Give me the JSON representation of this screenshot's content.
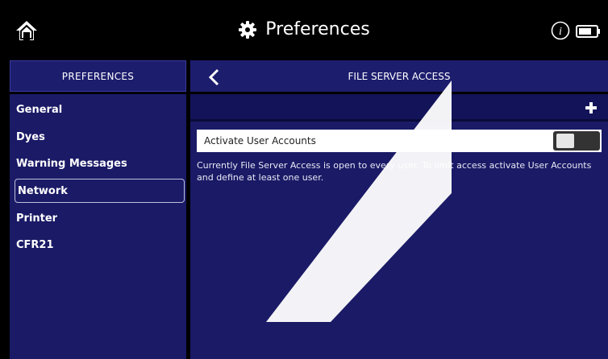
{
  "header": {
    "title": "Preferences",
    "home_icon": "home-icon",
    "gear_icon": "gear-icon",
    "info_icon": "info-icon",
    "battery_icon": "battery-icon"
  },
  "sidebar": {
    "title": "PREFERENCES",
    "items": [
      {
        "label": "General"
      },
      {
        "label": "Dyes"
      },
      {
        "label": "Warning Messages"
      },
      {
        "label": "Network",
        "selected": true
      },
      {
        "label": "Printer"
      },
      {
        "label": "CFR21"
      }
    ]
  },
  "main": {
    "title": "FILE SERVER ACCESS",
    "back_icon": "chevron-left-icon",
    "add_icon": "plus-icon",
    "activate_label": "Activate User Accounts",
    "activate_on": false,
    "description": "Currently File Server Access is open to every user. To limit access activate User Accounts and define at least one user."
  },
  "colors": {
    "panel": "#1a1a66",
    "header": "#1d1d6e",
    "background": "#000000"
  }
}
